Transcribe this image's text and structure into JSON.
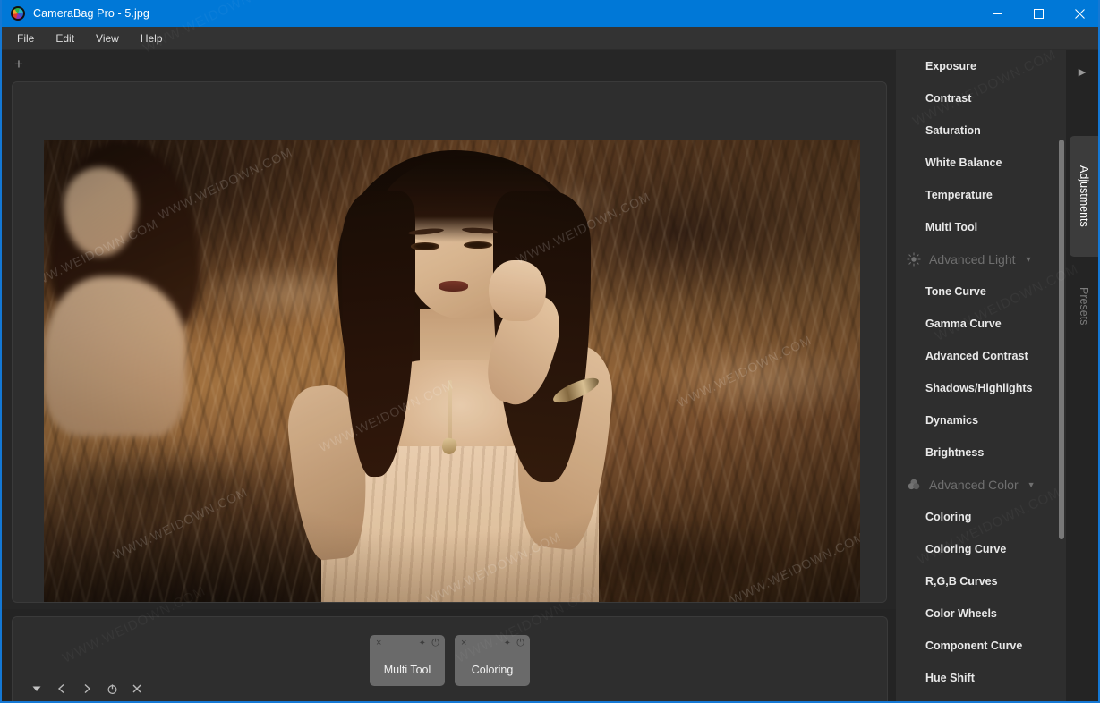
{
  "window": {
    "title": "CameraBag Pro - 5.jpg",
    "app_icon": "camerabag-color-wheel-icon",
    "controls": {
      "minimize": "minimize-icon",
      "maximize": "maximize-icon",
      "close": "close-icon"
    },
    "titlebar_color": "#0078d7",
    "border_color": "#1478d4"
  },
  "menubar": {
    "items": [
      {
        "label": "File"
      },
      {
        "label": "Edit"
      },
      {
        "label": "View"
      },
      {
        "label": "Help"
      }
    ]
  },
  "canvas": {
    "add_button_label": "+",
    "photo_alt": "Sepia-toned photo of a woman standing in rippling water, second woman blurred in background"
  },
  "filters": {
    "chips": [
      {
        "label": "Multi Tool",
        "close": "×",
        "pin": "✦",
        "power": "⏻"
      },
      {
        "label": "Coloring",
        "close": "×",
        "pin": "✦",
        "power": "⏻"
      }
    ]
  },
  "bottom_toolbar": {
    "icons": [
      {
        "name": "triangle-down-icon"
      },
      {
        "name": "previous-icon"
      },
      {
        "name": "next-icon"
      },
      {
        "name": "power-icon"
      },
      {
        "name": "close-icon"
      }
    ]
  },
  "adjustments": {
    "rail": {
      "expand_arrow": "▶",
      "tabs": [
        {
          "label": "Adjustments",
          "active": true
        },
        {
          "label": "Presets",
          "active": false
        }
      ]
    },
    "entries": [
      {
        "type": "item",
        "label": "Exposure"
      },
      {
        "type": "item",
        "label": "Contrast"
      },
      {
        "type": "item",
        "label": "Saturation"
      },
      {
        "type": "item",
        "label": "White Balance"
      },
      {
        "type": "item",
        "label": "Temperature"
      },
      {
        "type": "item",
        "label": "Multi Tool"
      },
      {
        "type": "group",
        "label": "Advanced Light",
        "icon": "sun-icon",
        "caret": "▼"
      },
      {
        "type": "item",
        "label": "Tone Curve"
      },
      {
        "type": "item",
        "label": "Gamma Curve"
      },
      {
        "type": "item",
        "label": "Advanced Contrast"
      },
      {
        "type": "item",
        "label": "Shadows/Highlights"
      },
      {
        "type": "item",
        "label": "Dynamics"
      },
      {
        "type": "item",
        "label": "Brightness"
      },
      {
        "type": "group",
        "label": "Advanced Color",
        "icon": "color-circles-icon",
        "caret": "▼"
      },
      {
        "type": "item",
        "label": "Coloring"
      },
      {
        "type": "item",
        "label": "Coloring Curve"
      },
      {
        "type": "item",
        "label": "R,G,B Curves"
      },
      {
        "type": "item",
        "label": "Color Wheels"
      },
      {
        "type": "item",
        "label": "Component Curve"
      },
      {
        "type": "item",
        "label": "Hue Shift"
      }
    ]
  },
  "watermarks": {
    "text": "WWW.WEIDOWN.COM"
  }
}
